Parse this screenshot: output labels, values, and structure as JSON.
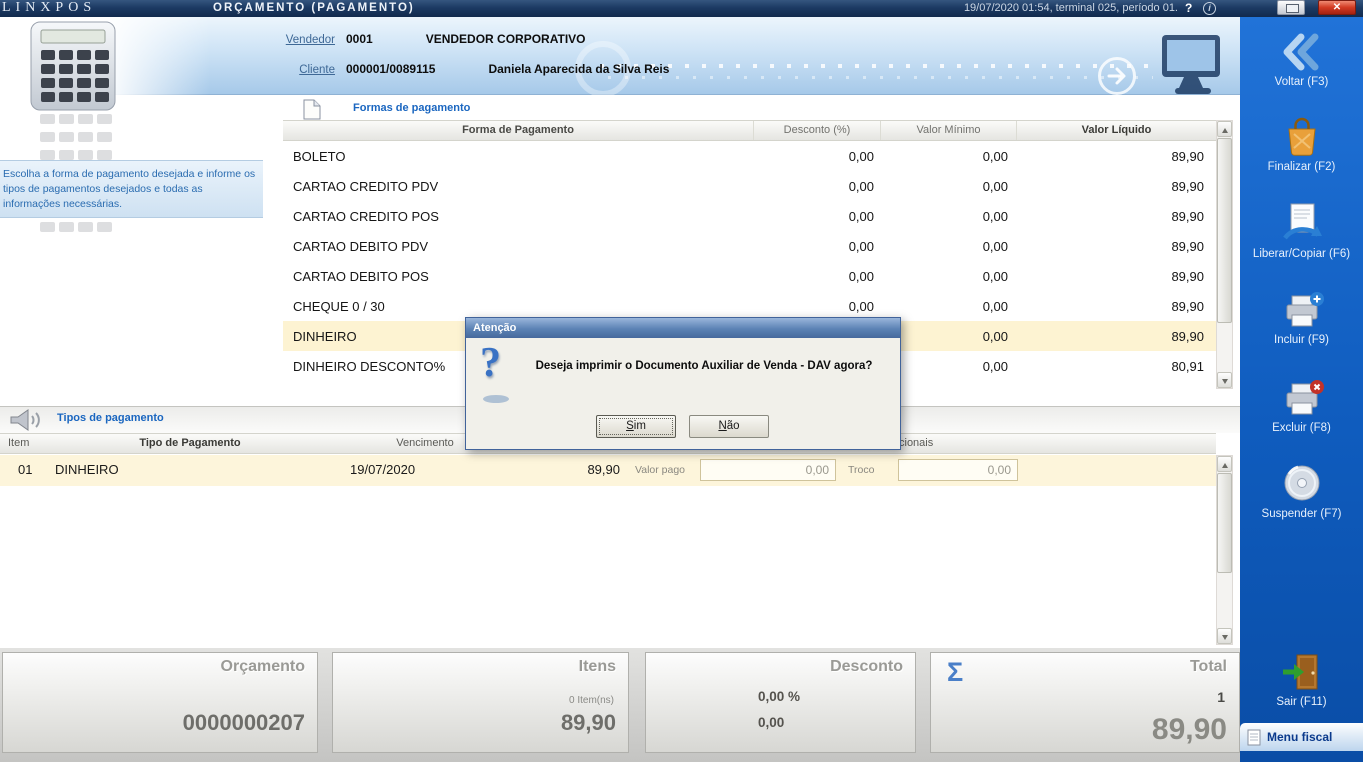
{
  "titlebar": {
    "logo": "LINXPOS",
    "title": "ORÇAMENTO (PAGAMENTO)",
    "status": "19/07/2020 01:54, terminal 025, período 01.",
    "help_glyph": "?",
    "info_glyph": "i",
    "close_glyph": "✕"
  },
  "header": {
    "vendedor_label": "Vendedor",
    "vendedor_code": "0001",
    "vendedor_name": "VENDEDOR CORPORATIVO",
    "cliente_label": "Cliente",
    "cliente_code": "000001/0089115",
    "cliente_name": "Daniela Aparecida da Silva Reis"
  },
  "instructions": "Escolha a forma de pagamento desejada e informe os tipos de pagamentos desejados e todas as informações necessárias.",
  "payment_forms": {
    "section_title": "Formas de pagamento",
    "columns": {
      "forma": "Forma de Pagamento",
      "desconto": "Desconto (%)",
      "valor_minimo": "Valor Mínimo",
      "valor_liquido": "Valor Líquido"
    },
    "rows": [
      {
        "name": "BOLETO",
        "desconto": "0,00",
        "minimo": "0,00",
        "liquido": "89,90"
      },
      {
        "name": "CARTAO CREDITO PDV",
        "desconto": "0,00",
        "minimo": "0,00",
        "liquido": "89,90"
      },
      {
        "name": "CARTAO CREDITO POS",
        "desconto": "0,00",
        "minimo": "0,00",
        "liquido": "89,90"
      },
      {
        "name": "CARTAO DEBITO PDV",
        "desconto": "0,00",
        "minimo": "0,00",
        "liquido": "89,90"
      },
      {
        "name": "CARTAO DEBITO POS",
        "desconto": "0,00",
        "minimo": "0,00",
        "liquido": "89,90"
      },
      {
        "name": "CHEQUE 0 / 30",
        "desconto": "0,00",
        "minimo": "0,00",
        "liquido": "89,90"
      },
      {
        "name": "DINHEIRO",
        "desconto": "",
        "minimo": "0,00",
        "liquido": "89,90"
      },
      {
        "name": "DINHEIRO DESCONTO%",
        "desconto": "",
        "minimo": "0,00",
        "liquido": "80,91"
      }
    ]
  },
  "dialog": {
    "title": "Atenção",
    "icon_glyph": "?",
    "message": "Deseja imprimir o Documento Auxiliar de Venda - DAV agora?",
    "yes_label": "Sim",
    "no_label": "Não"
  },
  "payment_types": {
    "section_title": "Tipos de pagamento",
    "columns": {
      "item": "Item",
      "tipo": "Tipo de Pagamento",
      "vencimento": "Vencimento",
      "adicionais_fragment": "cionais"
    },
    "row": {
      "item": "01",
      "tipo": "DINHEIRO",
      "vencimento": "19/07/2020",
      "valor": "89,90",
      "valor_pago_label": "Valor pago",
      "valor_pago": "0,00",
      "troco_label": "Troco",
      "troco": "0,00"
    }
  },
  "summary": {
    "orcamento_label": "Orçamento",
    "orcamento_value": "0000000207",
    "itens_label": "Itens",
    "itens_count": "0 Item(ns)",
    "itens_value": "89,90",
    "desconto_label": "Desconto",
    "desconto_percent": "0,00 %",
    "desconto_value": "0,00",
    "total_label": "Total",
    "total_sigma": "Σ",
    "total_count": "1",
    "total_value": "89,90"
  },
  "sidebar": {
    "buttons": [
      {
        "label": "Voltar (F3)"
      },
      {
        "label": "Finalizar (F2)"
      },
      {
        "label": "Liberar/Copiar (F6)"
      },
      {
        "label": "Incluir (F9)"
      },
      {
        "label": "Excluir (F8)"
      },
      {
        "label": "Suspender (F7)"
      },
      {
        "label": "Sair (F11)"
      }
    ],
    "menu_fiscal_label": "Menu fiscal"
  },
  "colors": {
    "sidebar_blue": "#1565c8",
    "titlebar_navy": "#1c3a63",
    "highlight_row_yellow": "#fdf3d2",
    "section_title_blue": "#1a66c0",
    "close_button_red": "#d23a22",
    "dialog_title_blue": "#5b82b4"
  }
}
